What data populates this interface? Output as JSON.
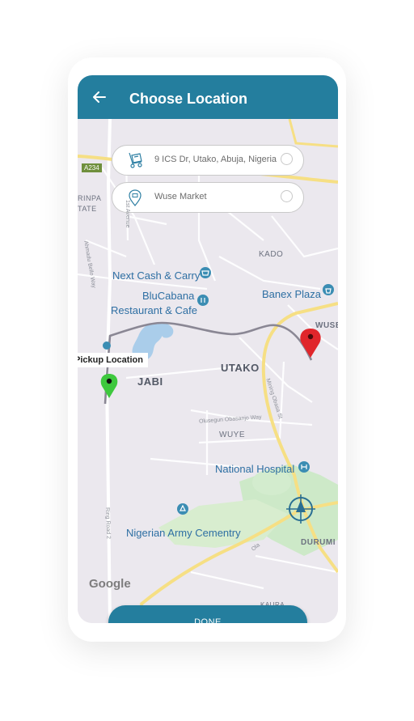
{
  "header": {
    "title": "Choose Location",
    "back_icon": "arrow-left-icon",
    "color": "#247e9e"
  },
  "search": {
    "pickup_value": "9 ICS Dr, Utako, Abuja, Nigeria",
    "pickup_icon": "trolley-icon",
    "destination_value": "Wuse Market",
    "destination_icon": "map-pin-icon"
  },
  "map": {
    "places": {
      "next_cash": "Next Cash & Carry",
      "blucabana_1": "BluCabana",
      "blucabana_2": "Restaurant & Cafe",
      "banex": "Banex Plaza",
      "national_hospital": "National Hospital",
      "army_cemetery": "Nigerian Army Cementry"
    },
    "areas": {
      "kado": "KADO",
      "jabi": "JABI",
      "utako": "UTAKO",
      "wuye": "WUYE",
      "durumi": "DURUMI",
      "kaura": "KAURA",
      "wuse": "WUSE",
      "rinpa": "RINPA",
      "tate": "TATE"
    },
    "streets": {
      "a234": "A234",
      "first_avenue": "1st Avenue",
      "olusegun": "Olusegun Obasanjo Way",
      "mining": "Mining Obasa St",
      "ring_road": "Ring Road 2",
      "ahmadu_bello": "Ahmadu Bello Way",
      "ola": "Ola"
    },
    "pickup_label": "Pickup Location",
    "pickup_pin_color": "#3ec83e",
    "dest_pin_color": "#e0262b",
    "route_color": "#8a8794",
    "attribution": "Google"
  },
  "done_label": "DONE"
}
